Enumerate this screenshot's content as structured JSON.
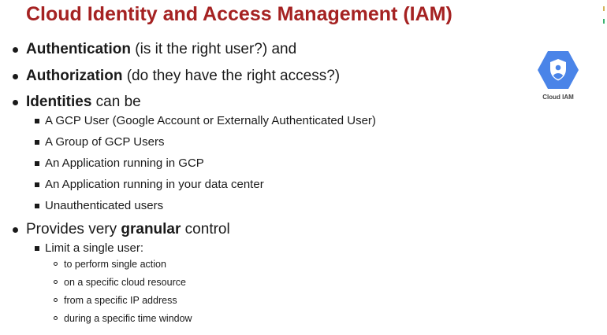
{
  "title": "Cloud Identity and Access Management (IAM)",
  "logo": {
    "label": "Cloud IAM",
    "icon": "cloud-iam-shield-hexagon",
    "color": "#4a84e8"
  },
  "bullets": [
    {
      "bold": "Authentication",
      "pre": "",
      "rest": " (is it the right user?) and"
    },
    {
      "bold": "Authorization",
      "pre": "",
      "rest": " (do they have the right access?)"
    },
    {
      "bold": "Identities",
      "pre": "",
      "rest": " can be",
      "children": [
        "A GCP User (Google Account or Externally Authenticated User)",
        "A Group of GCP Users",
        "An Application running in GCP",
        "An Application running in your data center",
        "Unauthenticated users"
      ]
    },
    {
      "pre": "Provides very ",
      "bold": "granular",
      "rest": " control",
      "children_label": "Limit a single user:",
      "sub": [
        "to perform single action",
        "on a specific cloud resource",
        "from a specific IP address",
        "during a specific time window"
      ]
    }
  ]
}
